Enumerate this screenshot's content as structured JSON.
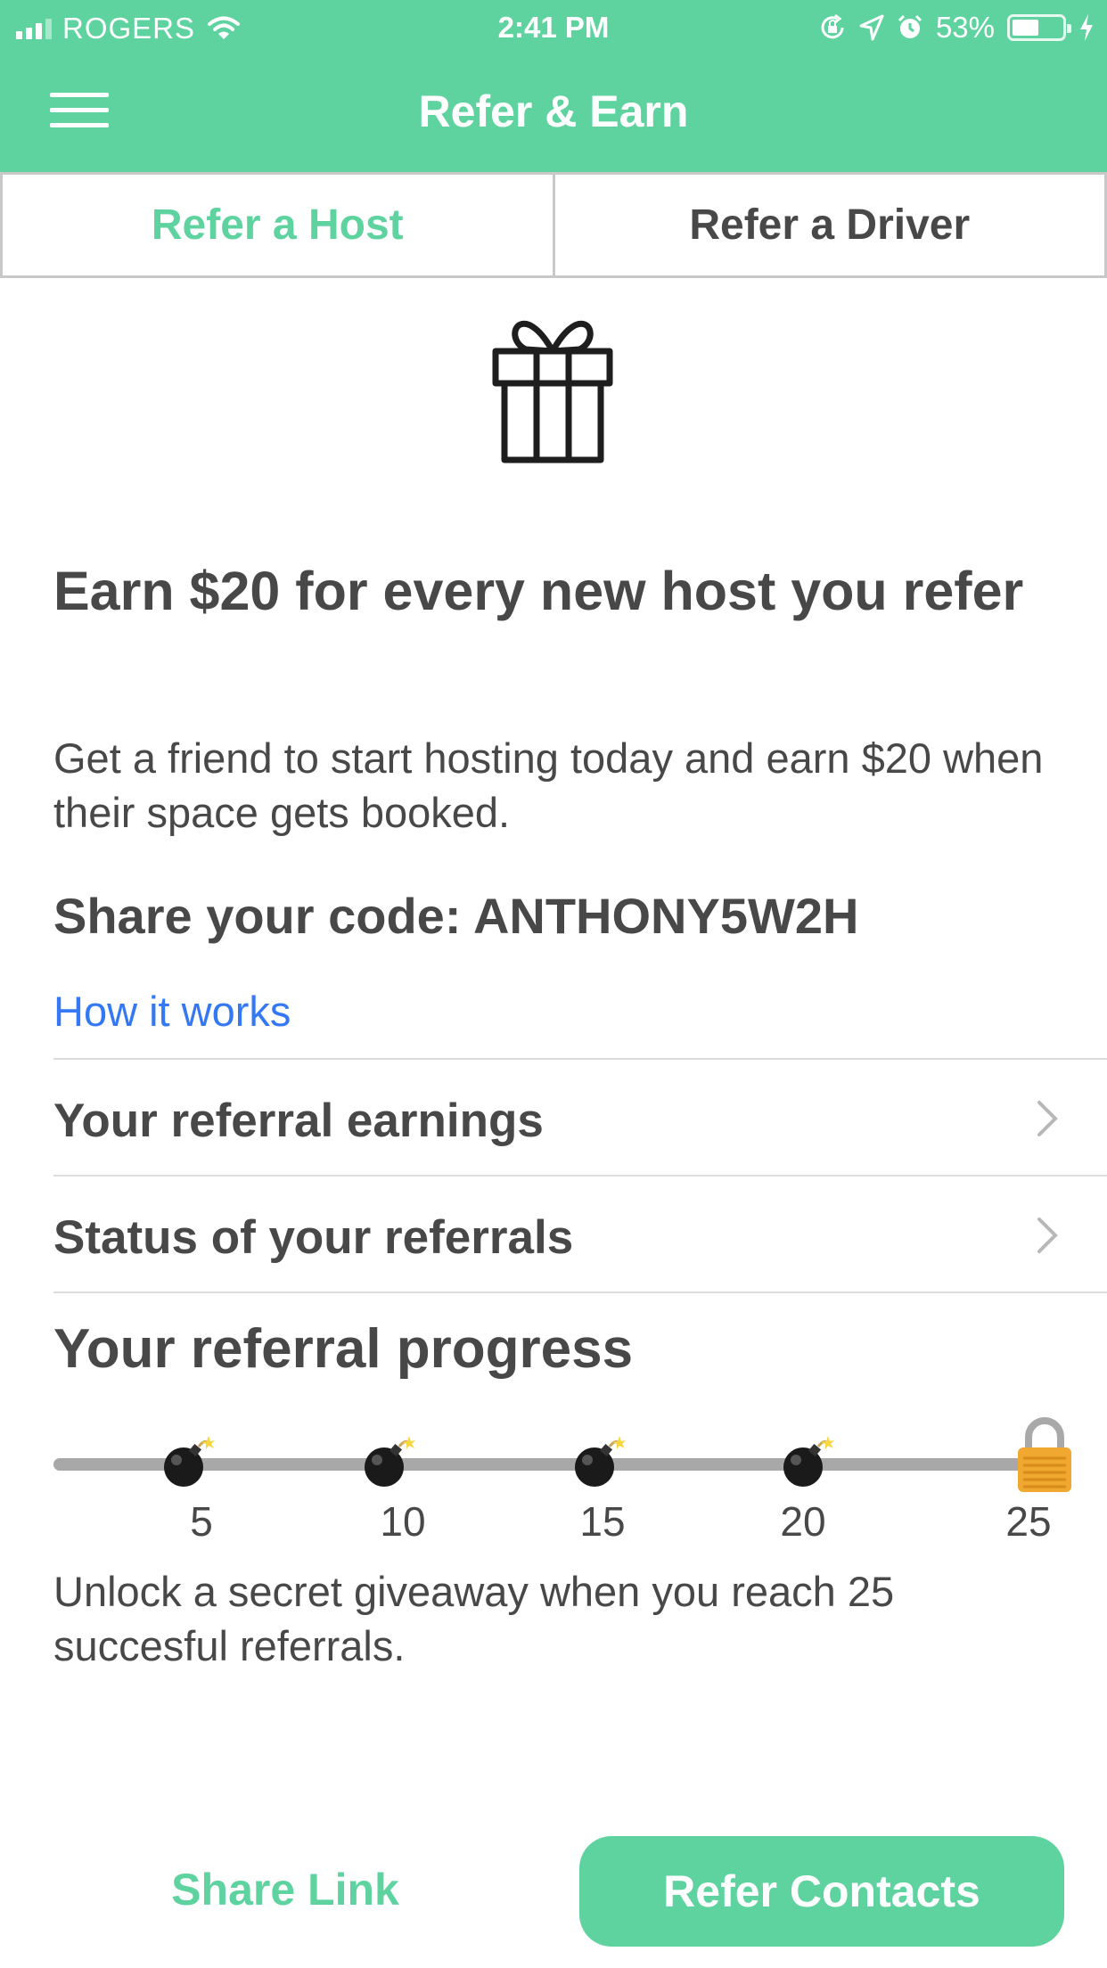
{
  "status_bar": {
    "carrier": "ROGERS",
    "time": "2:41 PM",
    "battery_percent": "53%",
    "battery_level": 0.53,
    "icons": [
      "signal-bars-icon",
      "wifi-icon",
      "orientation-lock-icon",
      "location-arrow-icon",
      "alarm-icon",
      "battery-icon",
      "charging-bolt-icon"
    ]
  },
  "header": {
    "title": "Refer & Earn",
    "menu_icon": "hamburger-menu-icon"
  },
  "tabs": [
    {
      "label": "Refer a Host",
      "active": true
    },
    {
      "label": "Refer a Driver",
      "active": false
    }
  ],
  "hero": {
    "icon": "gift-icon",
    "headline": "Earn $20 for every new host you refer",
    "description": "Get a friend to start hosting today and earn $20 when their space gets booked.",
    "code_line": "Share your code: ANTHONY5W2H",
    "how_link": "How it works"
  },
  "rows": [
    {
      "label": "Your referral earnings",
      "icon": "chevron-right-icon"
    },
    {
      "label": "Status of your referrals",
      "icon": "chevron-right-icon"
    }
  ],
  "progress": {
    "title": "Your referral progress",
    "milestones": [
      "5",
      "10",
      "15",
      "20",
      "25"
    ],
    "milestone_icon": "bomb-icon",
    "final_icon": "lock-icon",
    "note": "Unlock a secret giveaway when you reach 25 succesful referrals."
  },
  "actions": {
    "share_link": "Share Link",
    "refer_contacts": "Refer Contacts"
  },
  "colors": {
    "brand_green": "#5fd39f",
    "link_blue": "#3478f6",
    "text_dark": "#484848"
  }
}
